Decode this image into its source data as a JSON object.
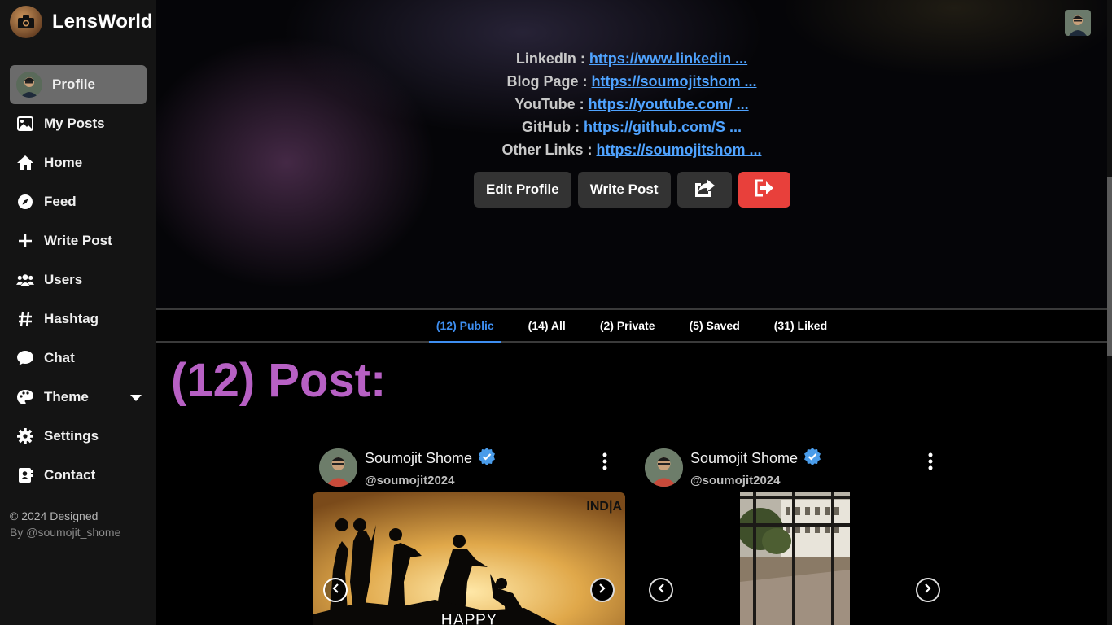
{
  "app": {
    "title": "LensWorld"
  },
  "sidebar": {
    "items": [
      {
        "label": "Profile",
        "icon": "avatar"
      },
      {
        "label": "My Posts",
        "icon": "image-icon"
      },
      {
        "label": "Home",
        "icon": "home-icon"
      },
      {
        "label": "Feed",
        "icon": "compass-icon"
      },
      {
        "label": "Write Post",
        "icon": "plus-icon"
      },
      {
        "label": "Users",
        "icon": "users-icon"
      },
      {
        "label": "Hashtag",
        "icon": "hashtag-icon"
      },
      {
        "label": "Chat",
        "icon": "chat-icon"
      },
      {
        "label": "Theme",
        "icon": "palette-icon"
      },
      {
        "label": "Settings",
        "icon": "gear-icon"
      },
      {
        "label": "Contact",
        "icon": "contact-icon"
      }
    ],
    "footer_line1": "© 2024 Designed",
    "footer_line2": "By @soumojit_shome"
  },
  "profile": {
    "links": [
      {
        "label": "LinkedIn : ",
        "value": "https://www.linkedin ..."
      },
      {
        "label": "Blog Page : ",
        "value": "https://soumojitshom ..."
      },
      {
        "label": "YouTube : ",
        "value": "https://youtube.com/ ..."
      },
      {
        "label": "GitHub : ",
        "value": "https://github.com/S ..."
      },
      {
        "label": "Other Links : ",
        "value": "https://soumojitshom ..."
      }
    ],
    "edit_label": "Edit Profile",
    "write_label": "Write Post"
  },
  "tabs": [
    {
      "label": "(12) Public",
      "active": true
    },
    {
      "label": "(14) All"
    },
    {
      "label": "(2) Private"
    },
    {
      "label": "(5) Saved"
    },
    {
      "label": "(31) Liked"
    }
  ],
  "posts_heading": "(12) Post:",
  "posts": [
    {
      "name": "Soumojit Shome",
      "handle": "@soumojit2024",
      "image_text": "HAPPY",
      "image_badge": "IND|A"
    },
    {
      "name": "Soumojit Shome",
      "handle": "@soumojit2024"
    }
  ],
  "colors": {
    "accent": "#3e8ef0",
    "heading": "#b760c4",
    "danger": "#e8403b",
    "link": "#4fa3ff"
  }
}
